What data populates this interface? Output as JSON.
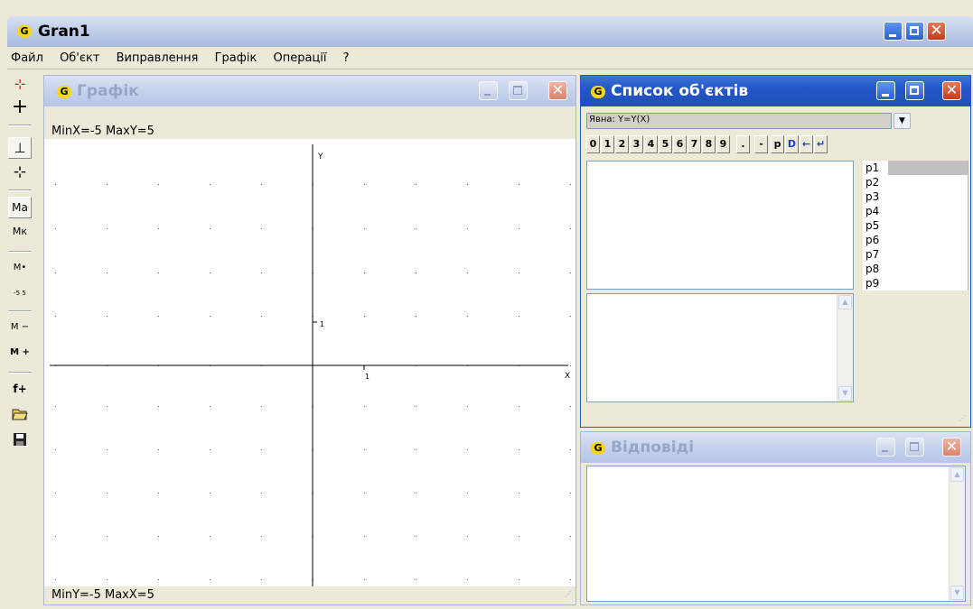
{
  "app": {
    "title": "Gran1",
    "icon": "gran-app-icon"
  },
  "menu": [
    "Файл",
    "Об'єкт",
    "Виправлення",
    "Графік",
    "Операції",
    "?"
  ],
  "toolbar": {
    "tools": [
      {
        "name": "plot-function-tool",
        "label": "⊹"
      },
      {
        "name": "add-point-tool",
        "label": "+"
      },
      {
        "name": "segment-tool",
        "label": "⊥"
      },
      {
        "name": "polyline-tool",
        "label": "⊹"
      },
      {
        "name": "scale-auto-tool",
        "label": "Ma"
      },
      {
        "name": "scale-coefficient-tool",
        "label": "Mк"
      },
      {
        "name": "move-tool",
        "label": "M•"
      },
      {
        "name": "range-tool",
        "label": "-5 5"
      },
      {
        "name": "zoom-out-tool",
        "label": "M −"
      },
      {
        "name": "zoom-in-tool",
        "label": "M +"
      },
      {
        "name": "add-function-tool",
        "label": "f+"
      },
      {
        "name": "open-icon",
        "label": "📂"
      },
      {
        "name": "save-icon",
        "label": "💾"
      }
    ]
  },
  "graph_window": {
    "title": "Графік",
    "top_status": "MinX=-5  MaxY=5",
    "bottom_status": "MinY=-5  MaxX=5",
    "axis_y_label": "Y",
    "axis_x_label": "X",
    "tick_x_label": "1",
    "tick_y_label": "1"
  },
  "objects_window": {
    "title": "Список об'єктів",
    "select_value": "Явна: Y=Y(X)",
    "keypad": [
      "0",
      "1",
      "2",
      "3",
      "4",
      "5",
      "6",
      "7",
      "8",
      "9",
      ".",
      "-",
      "p",
      "D",
      "←",
      "↵"
    ],
    "params": [
      "p1",
      "p2",
      "p3",
      "p4",
      "p5",
      "p6",
      "p7",
      "p8",
      "p9"
    ]
  },
  "answers_window": {
    "title": "Відповіді"
  },
  "colors": {
    "xp_blue": "#2457c8",
    "close_red": "#c63a1c",
    "face": "#ece9d8"
  }
}
